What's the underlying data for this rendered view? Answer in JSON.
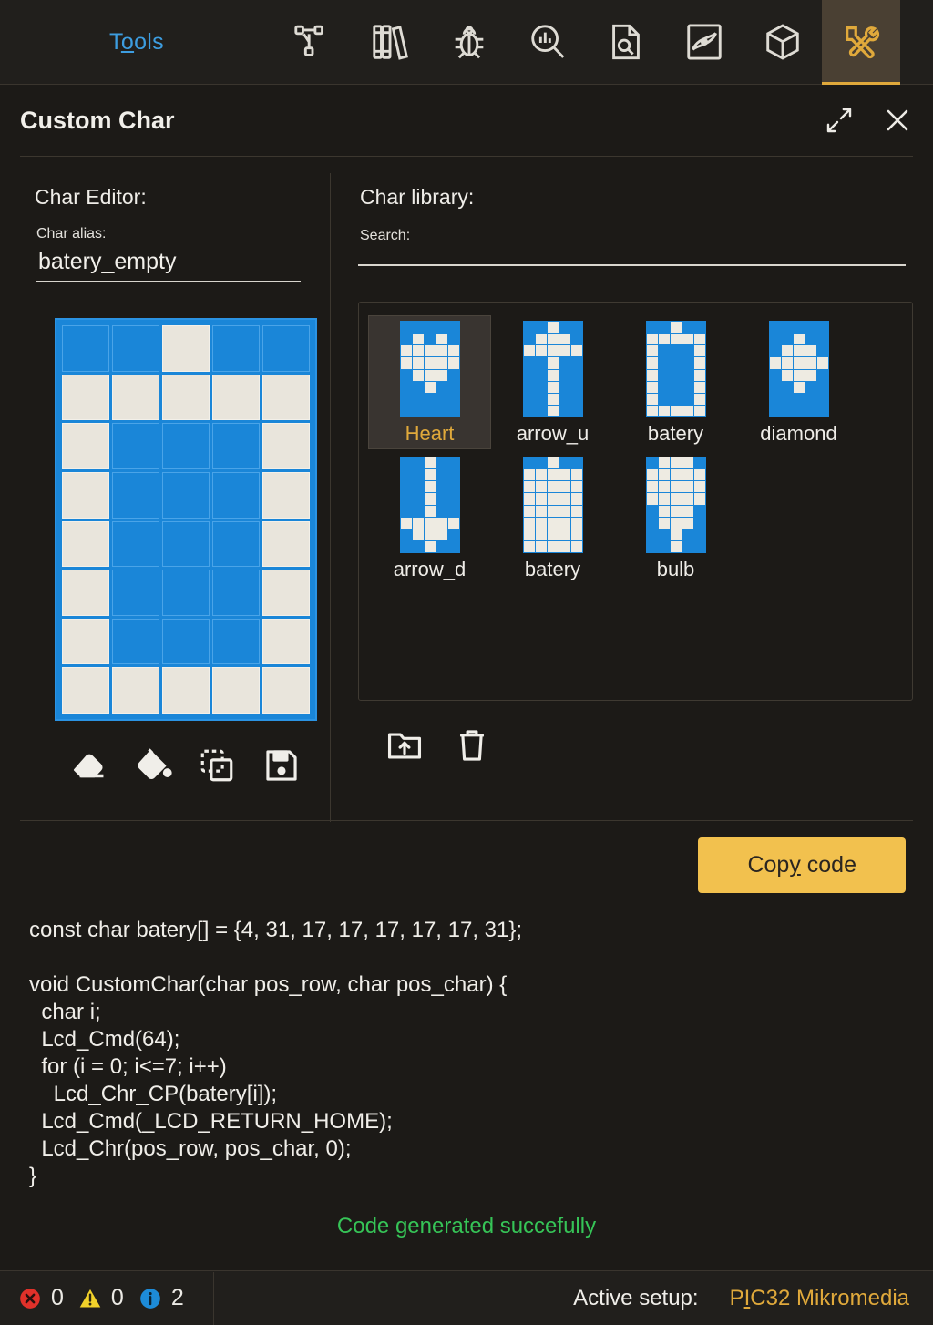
{
  "toolbar": {
    "menu_label": "Tools",
    "menu_accel": "o",
    "icons": [
      {
        "name": "git-branch-icon",
        "title": "Project tree"
      },
      {
        "name": "library-books-icon",
        "title": "Library manager"
      },
      {
        "name": "bug-icon",
        "title": "Debugger"
      },
      {
        "name": "statistics-search-icon",
        "title": "Statistics"
      },
      {
        "name": "document-search-icon",
        "title": "Code explorer"
      },
      {
        "name": "oscilloscope-icon",
        "title": "Oscilloscope"
      },
      {
        "name": "cube-icon",
        "title": "3D view"
      },
      {
        "name": "tools-wrench-screwdriver-icon",
        "title": "Tools",
        "active": true
      }
    ]
  },
  "dialog": {
    "title": "Custom Char",
    "maximize_icon": "expand-arrows-icon",
    "close_icon": "close-icon"
  },
  "editor": {
    "section_title": "Char Editor:",
    "alias_label": "Char alias:",
    "alias_value": "batery_empty",
    "grid": {
      "cols": 5,
      "rows": 8,
      "bytes": [
        4,
        31,
        17,
        17,
        17,
        17,
        17,
        31
      ],
      "pattern": [
        [
          0,
          0,
          1,
          0,
          0
        ],
        [
          1,
          1,
          1,
          1,
          1
        ],
        [
          1,
          0,
          0,
          0,
          1
        ],
        [
          1,
          0,
          0,
          0,
          1
        ],
        [
          1,
          0,
          0,
          0,
          1
        ],
        [
          1,
          0,
          0,
          0,
          1
        ],
        [
          1,
          0,
          0,
          0,
          1
        ],
        [
          1,
          1,
          1,
          1,
          1
        ]
      ]
    },
    "tools": [
      {
        "name": "eraser-icon",
        "label": "Erase"
      },
      {
        "name": "paint-bucket-icon",
        "label": "Fill"
      },
      {
        "name": "duplicate-icon",
        "label": "Duplicate"
      },
      {
        "name": "save-icon",
        "label": "Save"
      }
    ]
  },
  "library": {
    "section_title": "Char library:",
    "search_label": "Search:",
    "search_value": "",
    "search_placeholder": "",
    "items": [
      {
        "name": "Heart",
        "selected": true,
        "pattern": [
          [
            0,
            0,
            0,
            0,
            0
          ],
          [
            0,
            1,
            0,
            1,
            0
          ],
          [
            1,
            1,
            1,
            1,
            1
          ],
          [
            1,
            1,
            1,
            1,
            1
          ],
          [
            0,
            1,
            1,
            1,
            0
          ],
          [
            0,
            0,
            1,
            0,
            0
          ],
          [
            0,
            0,
            0,
            0,
            0
          ],
          [
            0,
            0,
            0,
            0,
            0
          ]
        ]
      },
      {
        "name": "arrow_u",
        "selected": false,
        "pattern": [
          [
            0,
            0,
            1,
            0,
            0
          ],
          [
            0,
            1,
            1,
            1,
            0
          ],
          [
            1,
            1,
            1,
            1,
            1
          ],
          [
            0,
            0,
            1,
            0,
            0
          ],
          [
            0,
            0,
            1,
            0,
            0
          ],
          [
            0,
            0,
            1,
            0,
            0
          ],
          [
            0,
            0,
            1,
            0,
            0
          ],
          [
            0,
            0,
            1,
            0,
            0
          ]
        ]
      },
      {
        "name": "batery",
        "selected": false,
        "pattern": [
          [
            0,
            0,
            1,
            0,
            0
          ],
          [
            1,
            1,
            1,
            1,
            1
          ],
          [
            1,
            0,
            0,
            0,
            1
          ],
          [
            1,
            0,
            0,
            0,
            1
          ],
          [
            1,
            0,
            0,
            0,
            1
          ],
          [
            1,
            0,
            0,
            0,
            1
          ],
          [
            1,
            0,
            0,
            0,
            1
          ],
          [
            1,
            1,
            1,
            1,
            1
          ]
        ]
      },
      {
        "name": "diamond",
        "selected": false,
        "pattern": [
          [
            0,
            0,
            0,
            0,
            0
          ],
          [
            0,
            0,
            1,
            0,
            0
          ],
          [
            0,
            1,
            1,
            1,
            0
          ],
          [
            1,
            1,
            1,
            1,
            1
          ],
          [
            0,
            1,
            1,
            1,
            0
          ],
          [
            0,
            0,
            1,
            0,
            0
          ],
          [
            0,
            0,
            0,
            0,
            0
          ],
          [
            0,
            0,
            0,
            0,
            0
          ]
        ]
      },
      {
        "name": "arrow_d",
        "selected": false,
        "pattern": [
          [
            0,
            0,
            1,
            0,
            0
          ],
          [
            0,
            0,
            1,
            0,
            0
          ],
          [
            0,
            0,
            1,
            0,
            0
          ],
          [
            0,
            0,
            1,
            0,
            0
          ],
          [
            0,
            0,
            1,
            0,
            0
          ],
          [
            1,
            1,
            1,
            1,
            1
          ],
          [
            0,
            1,
            1,
            1,
            0
          ],
          [
            0,
            0,
            1,
            0,
            0
          ]
        ]
      },
      {
        "name": "batery",
        "selected": false,
        "pattern": [
          [
            0,
            0,
            1,
            0,
            0
          ],
          [
            1,
            1,
            1,
            1,
            1
          ],
          [
            1,
            1,
            1,
            1,
            1
          ],
          [
            1,
            1,
            1,
            1,
            1
          ],
          [
            1,
            1,
            1,
            1,
            1
          ],
          [
            1,
            1,
            1,
            1,
            1
          ],
          [
            1,
            1,
            1,
            1,
            1
          ],
          [
            1,
            1,
            1,
            1,
            1
          ]
        ]
      },
      {
        "name": "bulb",
        "selected": false,
        "pattern": [
          [
            0,
            1,
            1,
            1,
            0
          ],
          [
            1,
            1,
            1,
            1,
            1
          ],
          [
            1,
            1,
            1,
            1,
            1
          ],
          [
            1,
            1,
            1,
            1,
            1
          ],
          [
            0,
            1,
            1,
            1,
            0
          ],
          [
            0,
            1,
            1,
            1,
            0
          ],
          [
            0,
            0,
            1,
            0,
            0
          ],
          [
            0,
            0,
            1,
            0,
            0
          ]
        ]
      }
    ],
    "tools": [
      {
        "name": "import-folder-icon",
        "label": "Import"
      },
      {
        "name": "delete-trash-icon",
        "label": "Delete"
      }
    ]
  },
  "code": {
    "copy_button_label": "Copy code",
    "copy_button_accel": "y",
    "text": "const char batery[] = {4, 31, 17, 17, 17, 17, 17, 31};\n\nvoid CustomChar(char pos_row, char pos_char) {\n  char i;\n  Lcd_Cmd(64);\n  for (i = 0; i<=7; i++)\n    Lcd_Chr_CP(batery[i]);\n  Lcd_Cmd(_LCD_RETURN_HOME);\n  Lcd_Chr(pos_row, pos_char, 0);\n}",
    "status_message": "Code generated succefully"
  },
  "statusbar": {
    "errors": "0",
    "warnings": "0",
    "infos": "2",
    "setup_label": "Active setup:",
    "setup_value": "PIC32 Mikromedia",
    "setup_accel": "I"
  },
  "colors": {
    "accent": "#e0a93b",
    "pixel_on": "#e9e5dc",
    "pixel_off": "#1a86d8",
    "success": "#36c457",
    "menu_link": "#3d9de0",
    "copy_button": "#f2c14e"
  }
}
